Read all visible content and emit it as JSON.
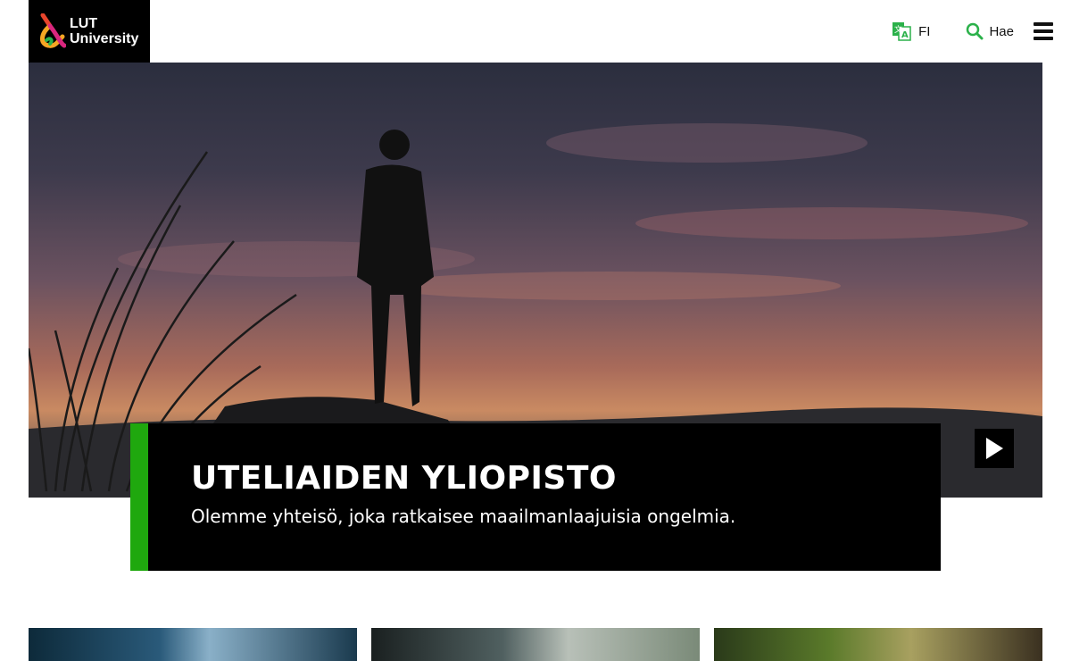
{
  "header": {
    "logo": {
      "line1": "LUT",
      "line2": "University"
    },
    "language": {
      "label": "FI",
      "icon": "translate-icon"
    },
    "search": {
      "label": "Hae",
      "icon": "search-icon"
    },
    "menu": {
      "icon": "hamburger-menu-icon"
    }
  },
  "hero": {
    "title": "UTELIAIDEN YLIOPISTO",
    "subtitle": "Olemme yhteisö, joka ratkaisee maailmanlaajuisia ongelmia.",
    "play_icon": "play-icon"
  },
  "colors": {
    "accent": "#1fa80e",
    "caption_bg": "#000000",
    "logo_bg": "#000000"
  },
  "cards": [
    {
      "name": "card-1"
    },
    {
      "name": "card-2"
    },
    {
      "name": "card-3"
    }
  ]
}
